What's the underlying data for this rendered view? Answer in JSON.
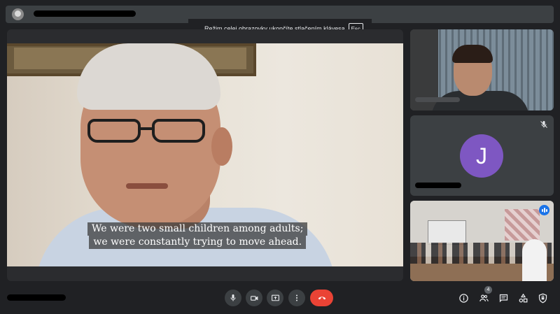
{
  "banner": {
    "message": "Režim celej obrazovky ukončíte stlačením klávesa",
    "key": "Esc"
  },
  "main_video": {
    "subtitle_line1": "We were two small children among adults;",
    "subtitle_line2": "we were constantly trying to move ahead."
  },
  "participants": {
    "avatar_letter": "J",
    "avatar_color": "#7e57c2"
  },
  "toolbar": {
    "people_count": "4",
    "end_call_color": "#ea4335",
    "buttons": [
      "mic-icon",
      "camera-icon",
      "present-screen-icon",
      "more-options-icon",
      "end-call-icon"
    ],
    "right_icons": [
      "info-icon",
      "people-icon",
      "chat-icon",
      "activities-icon",
      "host-controls-icon"
    ]
  },
  "colors": {
    "background": "#202124",
    "tile": "#3c4043",
    "speaking": "#1a73e8"
  }
}
